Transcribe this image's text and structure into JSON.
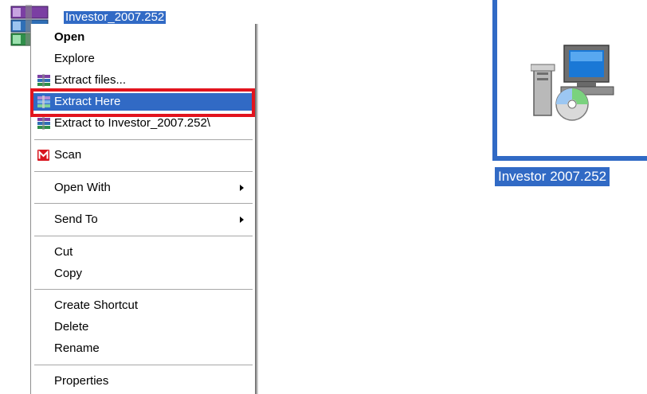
{
  "desktop": {
    "archive_label": "Investor_2007.252",
    "installer_label": "Investor 2007.252"
  },
  "context_menu": {
    "items": [
      {
        "label": "Open",
        "icon": null,
        "bold": true
      },
      {
        "label": "Explore",
        "icon": null
      },
      {
        "label": "Extract files...",
        "icon": "winrar-icon"
      },
      {
        "label": "Extract Here",
        "icon": "winrar-icon",
        "highlighted": true
      },
      {
        "label": "Extract to Investor_2007.252\\",
        "icon": "winrar-icon"
      },
      {
        "label": "Scan",
        "icon": "mcafee-icon"
      },
      {
        "label": "Open With",
        "submenu": true
      },
      {
        "label": "Send To",
        "submenu": true
      },
      {
        "label": "Cut"
      },
      {
        "label": "Copy"
      },
      {
        "label": "Create Shortcut"
      },
      {
        "label": "Delete"
      },
      {
        "label": "Rename"
      },
      {
        "label": "Properties"
      }
    ]
  },
  "colors": {
    "selection": "#316ac5",
    "annotation_frame": "#e2141e"
  }
}
